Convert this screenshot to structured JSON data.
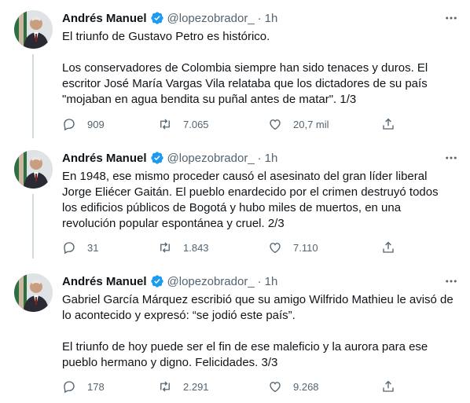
{
  "tweets": [
    {
      "author": "Andrés Manuel",
      "handle": "@lopezobrador_",
      "separator": "·",
      "time": "1h",
      "paragraphs": [
        "El triunfo de Gustavo Petro es histórico.",
        "Los conservadores de Colombia siempre han sido tenaces y duros. El escritor José María Vargas Vila relataba que los dictadores de su país \"mojaban en agua bendita su puñal antes de matar\". 1/3"
      ],
      "replies": "909",
      "retweets": "7.065",
      "likes": "20,7 mil"
    },
    {
      "author": "Andrés Manuel",
      "handle": "@lopezobrador_",
      "separator": "·",
      "time": "1h",
      "paragraphs": [
        "En 1948, ese mismo proceder causó el asesinato del gran líder liberal Jorge Eliécer Gaitán. El pueblo enardecido por el crimen destruyó todos los edificios públicos de Bogotá y hubo miles de muertos, en una revolución popular espontánea y cruel. 2/3"
      ],
      "replies": "31",
      "retweets": "1.843",
      "likes": "7.110"
    },
    {
      "author": "Andrés Manuel",
      "handle": "@lopezobrador_",
      "separator": "·",
      "time": "1h",
      "paragraphs": [
        "Gabriel García Márquez escribió que su amigo Wilfrido Mathieu le avisó de lo acontecido y expresó: “se jodió este país”.",
        "El triunfo de hoy puede ser el fin de ese maleficio y la aurora para ese pueblo hermano y digno. Felicidades. 3/3"
      ],
      "replies": "178",
      "retweets": "2.291",
      "likes": "9.268"
    }
  ],
  "icons": {
    "verified": "verified-badge-icon",
    "more": "more-icon",
    "reply": "reply-icon",
    "retweet": "retweet-icon",
    "like": "like-icon",
    "share": "share-icon"
  },
  "colors": {
    "text": "#0f1419",
    "secondary": "#536471",
    "verified": "#1d9bf0",
    "thread_line": "#cfd9de"
  }
}
